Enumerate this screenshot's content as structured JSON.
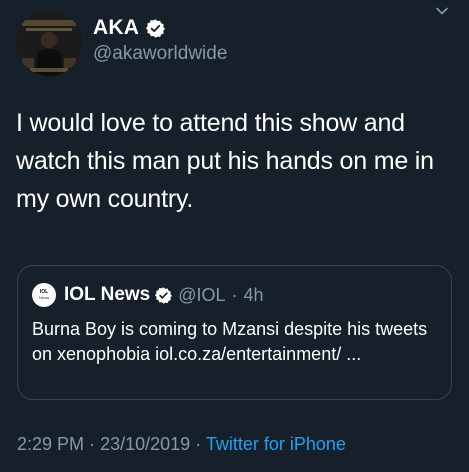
{
  "author": {
    "name": "AKA",
    "handle": "@akaworldwide",
    "verified": true
  },
  "tweet": {
    "text": "I would love to attend this show and watch this man put his hands on me in my own country."
  },
  "quoted": {
    "avatar_text_top": "IOL",
    "avatar_text_bottom": "News",
    "name": "IOL News",
    "verified": true,
    "handle": "@IOL",
    "separator": "·",
    "age": "4h",
    "text": "Burna Boy is coming to Mzansi despite his tweets on xenophobia iol.co.za/entertainment/ ..."
  },
  "footer": {
    "time": "2:29 PM",
    "separator": "·",
    "date": "23/10/2019",
    "source": "Twitter for iPhone"
  },
  "icons": {
    "verified": "verified-badge-icon",
    "menu": "chevron-down-icon"
  },
  "colors": {
    "background": "#15202b",
    "secondary_text": "#8899a6",
    "accent": "#1da1f2",
    "border": "#38444d"
  }
}
